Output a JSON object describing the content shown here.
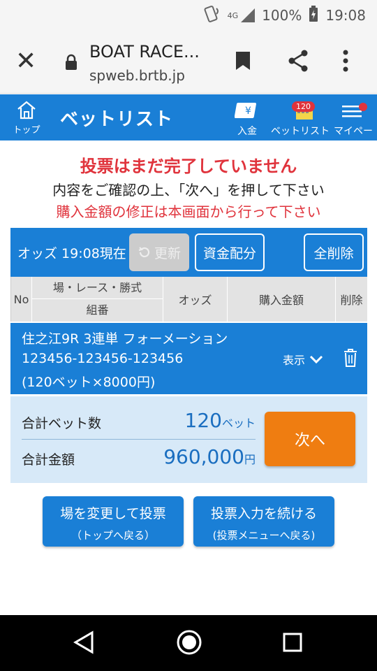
{
  "status": {
    "network": "4G",
    "battery": "100%",
    "time": "19:08"
  },
  "browser": {
    "title": "BOAT RACE...",
    "url": "spweb.brtb.jp"
  },
  "header": {
    "home_label": "トップ",
    "page_title": "ベットリスト",
    "deposit_label": "入金",
    "betlist_label": "ベットリスト",
    "betlist_badge": "120",
    "mypage_label": "マイページ"
  },
  "notice": {
    "line1": "投票はまだ完了していません",
    "line2": "内容をご確認の上、「次へ」を押して下さい",
    "line3": "購入金額の修正は本画面から行って下さい"
  },
  "odds_bar": {
    "odds_label": "オッズ 19:08現在",
    "refresh": "更新",
    "allocate": "資金配分",
    "clear_all": "全削除"
  },
  "table": {
    "headers": {
      "no": "No",
      "race": "場・レース・勝式",
      "combo": "組番",
      "odds": "オッズ",
      "amount": "購入金額",
      "delete": "削除"
    },
    "rows": [
      {
        "race": "住之江9R 3連単 フォーメーション",
        "combo": "123456-123456-123456",
        "detail": "(120ベット×8000円)",
        "show": "表示"
      }
    ]
  },
  "summary": {
    "bet_count_label": "合計ベット数",
    "bet_count": "120",
    "bet_unit": "ベット",
    "amount_label": "合計金額",
    "amount": "960,000",
    "amount_unit": "円",
    "next": "次へ"
  },
  "actions": {
    "change_venue": "場を変更して投票",
    "change_venue_sub": "（トップへ戻る）",
    "continue": "投票入力を続ける",
    "continue_sub": "(投票メニューへ戻る)"
  }
}
